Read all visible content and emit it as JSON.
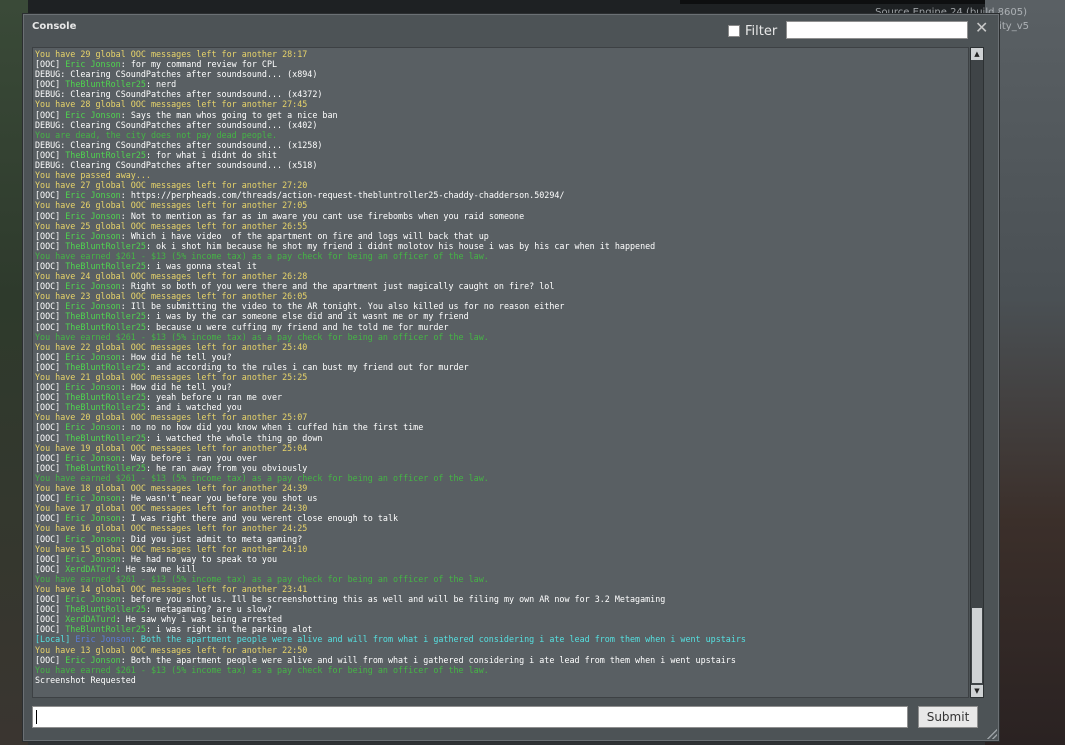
{
  "window": {
    "title": "Console",
    "filter_label": "Filter",
    "filter_value": "",
    "submit_label": "Submit",
    "command_value": "",
    "close_glyph": "✕"
  },
  "background": {
    "engine_text": "Source Engine 24 (build 8605)",
    "engine_text2": "ity_v5"
  },
  "lines": [
    [
      [
        "c-yellow",
        "You have 29 global OOC messages left for another 28:17"
      ]
    ],
    [
      [
        "c-white",
        "[OOC] "
      ],
      [
        "c-green",
        "Eric Jonson"
      ],
      [
        "c-white",
        ": for my command review for CPL"
      ]
    ],
    [
      [
        "c-white",
        "DEBUG: Clearing CSoundPatches after soundsound... (x894)"
      ]
    ],
    [
      [
        "c-white",
        "[OOC] "
      ],
      [
        "c-green",
        "TheBluntRoller25"
      ],
      [
        "c-white",
        ": nerd"
      ]
    ],
    [
      [
        "c-white",
        "DEBUG: Clearing CSoundPatches after soundsound... (x4372)"
      ]
    ],
    [
      [
        "c-yellow",
        "You have 28 global OOC messages left for another 27:45"
      ]
    ],
    [
      [
        "c-white",
        "[OOC] "
      ],
      [
        "c-green",
        "Eric Jonson"
      ],
      [
        "c-white",
        ": Says the man whos going to get a nice ban"
      ]
    ],
    [
      [
        "c-white",
        "DEBUG: Clearing CSoundPatches after soundsound... (x402)"
      ]
    ],
    [
      [
        "c-dimgreen",
        "You are dead, the city does not pay dead people."
      ]
    ],
    [
      [
        "c-white",
        "DEBUG: Clearing CSoundPatches after soundsound... (x1258)"
      ]
    ],
    [
      [
        "c-white",
        "[OOC] "
      ],
      [
        "c-green",
        "TheBluntRoller25"
      ],
      [
        "c-white",
        ": for what i didnt do shit"
      ]
    ],
    [
      [
        "c-white",
        "DEBUG: Clearing CSoundPatches after soundsound... (x518)"
      ]
    ],
    [
      [
        "c-yellow",
        "You have passed away..."
      ]
    ],
    [
      [
        "c-yellow",
        "You have 27 global OOC messages left for another 27:20"
      ]
    ],
    [
      [
        "c-white",
        "[OOC] "
      ],
      [
        "c-green",
        "Eric Jonson"
      ],
      [
        "c-white",
        ": https://perpheads.com/threads/action-request-thebluntroller25-chaddy-chadderson.50294/"
      ]
    ],
    [
      [
        "c-yellow",
        "You have 26 global OOC messages left for another 27:05"
      ]
    ],
    [
      [
        "c-white",
        "[OOC] "
      ],
      [
        "c-green",
        "Eric Jonson"
      ],
      [
        "c-white",
        ": Not to mention as far as im aware you cant use firebombs when you raid someone"
      ]
    ],
    [
      [
        "c-yellow",
        "You have 25 global OOC messages left for another 26:55"
      ]
    ],
    [
      [
        "c-white",
        "[OOC] "
      ],
      [
        "c-green",
        "Eric Jonson"
      ],
      [
        "c-white",
        ": Which i have video  of the apartment on fire and logs will back that up"
      ]
    ],
    [
      [
        "c-white",
        "[OOC] "
      ],
      [
        "c-green",
        "TheBluntRoller25"
      ],
      [
        "c-white",
        ": ok i shot him because he shot my friend i didnt molotov his house i was by his car when it happened"
      ]
    ],
    [
      [
        "c-dimgreen",
        "You have earned $261 - $13 (5% income tax) as a pay check for being an officer of the law."
      ]
    ],
    [
      [
        "c-white",
        "[OOC] "
      ],
      [
        "c-green",
        "TheBluntRoller25"
      ],
      [
        "c-white",
        ": i was gonna steal it"
      ]
    ],
    [
      [
        "c-yellow",
        "You have 24 global OOC messages left for another 26:28"
      ]
    ],
    [
      [
        "c-white",
        "[OOC] "
      ],
      [
        "c-green",
        "Eric Jonson"
      ],
      [
        "c-white",
        ": Right so both of you were there and the apartment just magically caught on fire? lol"
      ]
    ],
    [
      [
        "c-yellow",
        "You have 23 global OOC messages left for another 26:05"
      ]
    ],
    [
      [
        "c-white",
        "[OOC] "
      ],
      [
        "c-green",
        "Eric Jonson"
      ],
      [
        "c-white",
        ": Ill be submitting the video to the AR tonight. You also killed us for no reason either"
      ]
    ],
    [
      [
        "c-white",
        "[OOC] "
      ],
      [
        "c-green",
        "TheBluntRoller25"
      ],
      [
        "c-white",
        ": i was by the car someone else did and it wasnt me or my friend"
      ]
    ],
    [
      [
        "c-white",
        "[OOC] "
      ],
      [
        "c-green",
        "TheBluntRoller25"
      ],
      [
        "c-white",
        ": because u were cuffing my friend and he told me for murder"
      ]
    ],
    [
      [
        "c-dimgreen",
        "You have earned $261 - $13 (5% income tax) as a pay check for being an officer of the law."
      ]
    ],
    [
      [
        "c-yellow",
        "You have 22 global OOC messages left for another 25:40"
      ]
    ],
    [
      [
        "c-white",
        "[OOC] "
      ],
      [
        "c-green",
        "Eric Jonson"
      ],
      [
        "c-white",
        ": How did he tell you?"
      ]
    ],
    [
      [
        "c-white",
        "[OOC] "
      ],
      [
        "c-green",
        "TheBluntRoller25"
      ],
      [
        "c-white",
        ": and according to the rules i can bust my friend out for murder"
      ]
    ],
    [
      [
        "c-yellow",
        "You have 21 global OOC messages left for another 25:25"
      ]
    ],
    [
      [
        "c-white",
        "[OOC] "
      ],
      [
        "c-green",
        "Eric Jonson"
      ],
      [
        "c-white",
        ": How did he tell you?"
      ]
    ],
    [
      [
        "c-white",
        "[OOC] "
      ],
      [
        "c-green",
        "TheBluntRoller25"
      ],
      [
        "c-white",
        ": yeah before u ran me over"
      ]
    ],
    [
      [
        "c-white",
        "[OOC] "
      ],
      [
        "c-green",
        "TheBluntRoller25"
      ],
      [
        "c-white",
        ": and i watched you"
      ]
    ],
    [
      [
        "c-yellow",
        "You have 20 global OOC messages left for another 25:07"
      ]
    ],
    [
      [
        "c-white",
        "[OOC] "
      ],
      [
        "c-green",
        "Eric Jonson"
      ],
      [
        "c-white",
        ": no no no how did you know when i cuffed him the first time"
      ]
    ],
    [
      [
        "c-white",
        "[OOC] "
      ],
      [
        "c-green",
        "TheBluntRoller25"
      ],
      [
        "c-white",
        ": i watched the whole thing go down"
      ]
    ],
    [
      [
        "c-yellow",
        "You have 19 global OOC messages left for another 25:04"
      ]
    ],
    [
      [
        "c-white",
        "[OOC] "
      ],
      [
        "c-green",
        "Eric Jonson"
      ],
      [
        "c-white",
        ": Way before i ran you over"
      ]
    ],
    [
      [
        "c-white",
        "[OOC] "
      ],
      [
        "c-green",
        "TheBluntRoller25"
      ],
      [
        "c-white",
        ": he ran away from you obviously"
      ]
    ],
    [
      [
        "c-dimgreen",
        "You have earned $261 - $13 (5% income tax) as a pay check for being an officer of the law."
      ]
    ],
    [
      [
        "c-yellow",
        "You have 18 global OOC messages left for another 24:39"
      ]
    ],
    [
      [
        "c-white",
        "[OOC] "
      ],
      [
        "c-green",
        "Eric Jonson"
      ],
      [
        "c-white",
        ": He wasn't near you before you shot us"
      ]
    ],
    [
      [
        "c-yellow",
        "You have 17 global OOC messages left for another 24:30"
      ]
    ],
    [
      [
        "c-white",
        "[OOC] "
      ],
      [
        "c-green",
        "Eric Jonson"
      ],
      [
        "c-white",
        ": I was right there and you werent close enough to talk"
      ]
    ],
    [
      [
        "c-yellow",
        "You have 16 global OOC messages left for another 24:25"
      ]
    ],
    [
      [
        "c-white",
        "[OOC] "
      ],
      [
        "c-green",
        "Eric Jonson"
      ],
      [
        "c-white",
        ": Did you just admit to meta gaming?"
      ]
    ],
    [
      [
        "c-yellow",
        "You have 15 global OOC messages left for another 24:10"
      ]
    ],
    [
      [
        "c-white",
        "[OOC] "
      ],
      [
        "c-green",
        "Eric Jonson"
      ],
      [
        "c-white",
        ": He had no way to speak to you"
      ]
    ],
    [
      [
        "c-white",
        "[OOC] "
      ],
      [
        "c-green",
        "XerdDATurd"
      ],
      [
        "c-white",
        ": He saw me kill"
      ]
    ],
    [
      [
        "c-dimgreen",
        "You have earned $261 - $13 (5% income tax) as a pay check for being an officer of the law."
      ]
    ],
    [
      [
        "c-yellow",
        "You have 14 global OOC messages left for another 23:41"
      ]
    ],
    [
      [
        "c-white",
        "[OOC] "
      ],
      [
        "c-green",
        "Eric Jonson"
      ],
      [
        "c-white",
        ": before you shot us. Ill be screenshotting this as well and will be filing my own AR now for 3.2 Metagaming"
      ]
    ],
    [
      [
        "c-white",
        "[OOC] "
      ],
      [
        "c-green",
        "TheBluntRoller25"
      ],
      [
        "c-white",
        ": metagaming? are u slow?"
      ]
    ],
    [
      [
        "c-white",
        "[OOC] "
      ],
      [
        "c-green",
        "XerdDATurd"
      ],
      [
        "c-white",
        ": He saw why i was being arrested"
      ]
    ],
    [
      [
        "c-white",
        "[OOC] "
      ],
      [
        "c-green",
        "TheBluntRoller25"
      ],
      [
        "c-white",
        ": i was right in the parking alot"
      ]
    ],
    [
      [
        "c-cyan",
        "[Local] "
      ],
      [
        "c-blue",
        "Eric Jonson"
      ],
      [
        "c-cyan",
        ": Both the apartment people were alive and will from what i gathered considering i ate lead from them when i went upstairs"
      ]
    ],
    [
      [
        "c-yellow",
        "You have 13 global OOC messages left for another 22:50"
      ]
    ],
    [
      [
        "c-white",
        "[OOC] "
      ],
      [
        "c-green",
        "Eric Jonson"
      ],
      [
        "c-white",
        ": Both the apartment people were alive and will from what i gathered considering i ate lead from them when i went upstairs"
      ]
    ],
    [
      [
        "c-dimgreen",
        "You have earned $261 - $13 (5% income tax) as a pay check for being an officer of the law."
      ]
    ],
    [
      [
        "c-white",
        "Screenshot Requested"
      ]
    ]
  ]
}
